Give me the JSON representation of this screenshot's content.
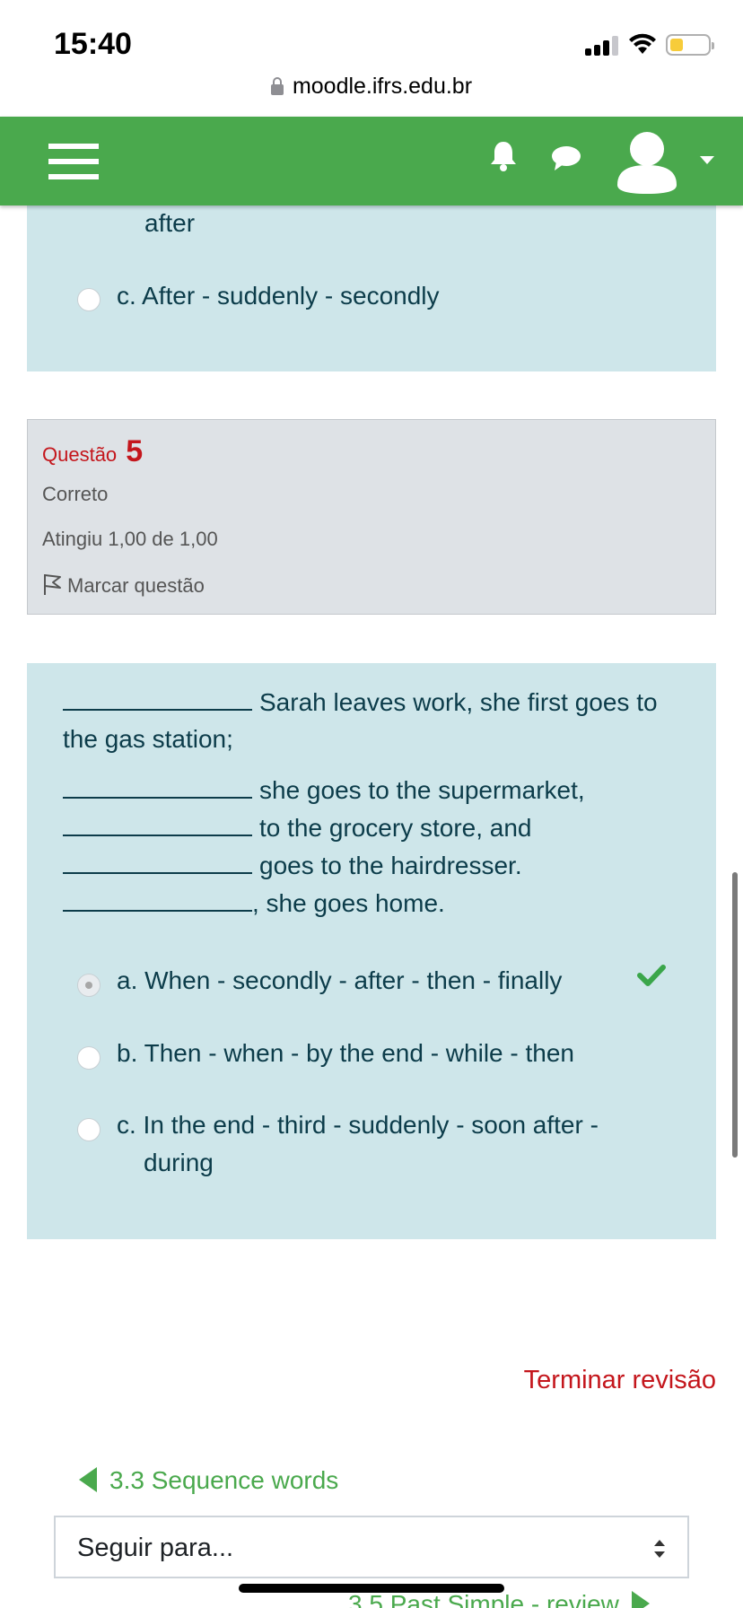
{
  "status_bar": {
    "time": "15:40"
  },
  "browser": {
    "url": "moodle.ifrs.edu.br"
  },
  "prev_question": {
    "option_b_tail": "after",
    "option_c": "c. After - suddenly - secondly"
  },
  "question5": {
    "label": "Questão",
    "number": "5",
    "state": "Correto",
    "grade": "Atingiu 1,00 de 1,00",
    "flag_label": "Marcar questão",
    "text_line1": "Sarah leaves work, she first goes to",
    "text_line2": "the gas station;",
    "text_line3": "she goes to the supermarket,",
    "text_line4": "to the grocery store, and",
    "text_line5": "goes to the hairdresser.",
    "text_line6": ", she goes home.",
    "option_a": "a. When - secondly - after - then - finally",
    "option_b": "b. Then - when - by the end - while - then",
    "option_c_line1": "c. In the end - third - suddenly - soon after -",
    "option_c_line2": "during",
    "selected": "a"
  },
  "footer": {
    "finish_review": "Terminar revisão",
    "prev_activity": "3.3 Sequence words",
    "jump_select": "Seguir para...",
    "next_activity": "3.5 Past Simple - review"
  },
  "colors": {
    "navbar": "#4aa94d",
    "question_bg": "#cee6ea",
    "info_bg": "#dee2e6",
    "accent_red": "#c4161c",
    "link_green": "#4aa94d"
  }
}
